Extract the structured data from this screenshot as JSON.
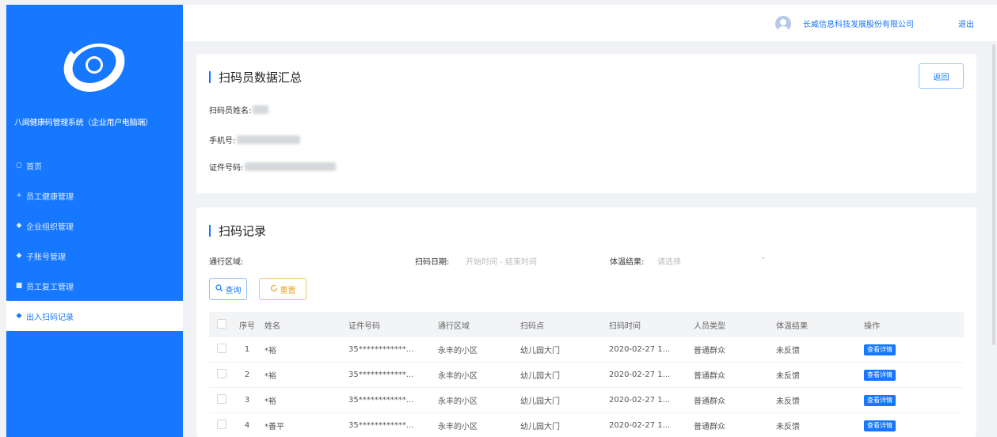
{
  "sidebar": {
    "system_name": "八闽健康码管理系统（企业用户电脑端）",
    "menu": [
      {
        "icon": "○",
        "label": "首页",
        "active": false
      },
      {
        "icon": "+",
        "label": "员工健康管理",
        "active": false
      },
      {
        "icon": "◆",
        "label": "企业组织管理",
        "active": false
      },
      {
        "icon": "◆",
        "label": "子账号管理",
        "active": false
      },
      {
        "icon": "■",
        "label": "员工复工管理",
        "active": false
      },
      {
        "icon": "◆",
        "label": "出入扫码记录",
        "active": true
      }
    ]
  },
  "header": {
    "company": "长威信息科技发展股份有限公司",
    "logout": "退出"
  },
  "summary": {
    "title": "扫码员数据汇总",
    "back_label": "返回",
    "name_label": "扫码员姓名:",
    "phone_label": "手机号:",
    "id_label": "证件号码:"
  },
  "records": {
    "title": "扫码记录",
    "filters": {
      "area_label": "通行区域:",
      "date_label": "扫码日期:",
      "date_placeholder": "开始时间 - 结束时间",
      "temp_label": "体温结果:",
      "temp_placeholder": "请选择"
    },
    "search_label": "查询",
    "reset_label": "重置",
    "columns": [
      "序号",
      "姓名",
      "证件号码",
      "通行区域",
      "扫码点",
      "扫码时间",
      "人员类型",
      "体温结果",
      "操作"
    ],
    "rows": [
      {
        "index": "1",
        "name": "*裕",
        "id": "35************...",
        "area": "永丰的小区",
        "point": "幼儿园大门",
        "time": "2020-02-27 1...",
        "type": "普通群众",
        "temp": "未反馈",
        "action": "查看详情"
      },
      {
        "index": "2",
        "name": "*裕",
        "id": "35************...",
        "area": "永丰的小区",
        "point": "幼儿园大门",
        "time": "2020-02-27 1...",
        "type": "普通群众",
        "temp": "未反馈",
        "action": "查看详情"
      },
      {
        "index": "3",
        "name": "*裕",
        "id": "35************...",
        "area": "永丰的小区",
        "point": "幼儿园大门",
        "time": "2020-02-27 1...",
        "type": "普通群众",
        "temp": "未反馈",
        "action": "查看详情"
      },
      {
        "index": "4",
        "name": "*善平",
        "id": "35************...",
        "area": "永丰的小区",
        "point": "幼儿园大门",
        "time": "2020-02-27 1...",
        "type": "普通群众",
        "temp": "未反馈",
        "action": "查看详情"
      }
    ]
  },
  "colors": {
    "primary": "#1677ff",
    "warning": "#f0a020",
    "background": "#f0f2f5"
  }
}
